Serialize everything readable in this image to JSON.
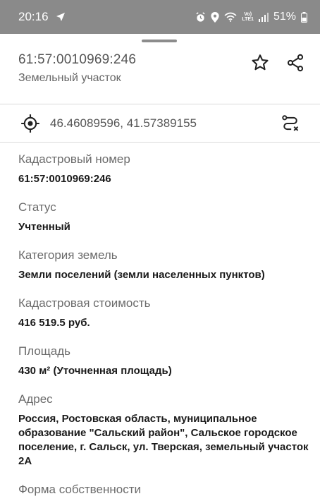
{
  "status_bar": {
    "time": "20:16",
    "lte_label": "LTE1",
    "volte_label": "Vo)",
    "battery": "51%",
    "icons": [
      "navigation-arrow-icon",
      "alarm-icon",
      "location-pin-icon",
      "wifi-icon",
      "signal-icon",
      "battery-icon"
    ]
  },
  "header": {
    "title": "61:57:0010969:246",
    "subtitle": "Земельный участок"
  },
  "coordinates": {
    "text": "46.46089596, 41.57389155"
  },
  "fields": [
    {
      "label": "Кадастровый номер",
      "value": "61:57:0010969:246"
    },
    {
      "label": "Статус",
      "value": "Учтенный"
    },
    {
      "label": "Категория земель",
      "value": "Земли поселений (земли населенных пунктов)"
    },
    {
      "label": "Кадастровая стоимость",
      "value": "416 519.5 руб."
    },
    {
      "label": "Площадь",
      "value": "430 м² (Уточненная площадь)"
    },
    {
      "label": "Адрес",
      "value": "Россия, Ростовская область, муниципальное образование \"Сальский район\", Сальское городское поселение, г. Сальск, ул. Тверская, земельный участок 2А"
    },
    {
      "label": "Форма собственности",
      "value": ""
    }
  ]
}
